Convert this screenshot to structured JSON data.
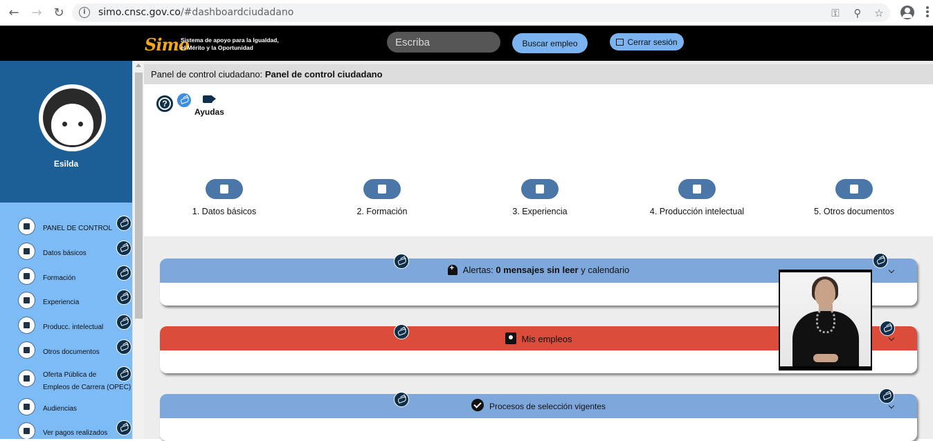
{
  "browser": {
    "url_host": "simo.cnsc.gov.co",
    "url_path": "/#dashboardciudadano"
  },
  "header": {
    "logo_text": "Simo",
    "logo_tagline_1": "Sistema de apoyo para la Igualdad,",
    "logo_tagline_2": "el Mérito y la Oportunidad",
    "search_placeholder": "Escriba",
    "search_button": "Buscar empleo",
    "logout_button": "Cerrar sesión"
  },
  "sidebar": {
    "user_name": "Esilda",
    "items": [
      {
        "label": "PANEL DE CONTROL",
        "icon": "dashboard-icon"
      },
      {
        "label": "Datos básicos",
        "icon": "people-icon"
      },
      {
        "label": "Formación",
        "icon": "book-icon"
      },
      {
        "label": "Experiencia",
        "icon": "briefcase-icon"
      },
      {
        "label": "Producc. intelectual",
        "icon": "library-icon"
      },
      {
        "label": "Otros documentos",
        "icon": "document-icon"
      },
      {
        "label": "Oferta Pública de",
        "label2": "Empleos de Carrera (OPEC)",
        "icon": "opec-icon"
      },
      {
        "label": "Audiencias",
        "icon": "audience-icon"
      },
      {
        "label": "Ver pagos realizados",
        "icon": "dollar-icon"
      }
    ]
  },
  "main": {
    "breadcrumb_prefix": "Panel de control ciudadano:",
    "breadcrumb_current": "Panel de control ciudadano",
    "help_label": "Ayudas",
    "steps": [
      {
        "label": "1. Datos básicos",
        "icon": "people-icon"
      },
      {
        "label": "2. Formación",
        "icon": "book-icon"
      },
      {
        "label": "3. Experiencia",
        "icon": "briefcase-icon"
      },
      {
        "label": "4. Producción intelectual",
        "icon": "library-icon"
      },
      {
        "label": "5. Otros documentos",
        "icon": "document-icon"
      }
    ],
    "cards": {
      "alerts_prefix": "Alertas:",
      "alerts_bold": "0 mensajes sin leer",
      "alerts_suffix": "y calendario",
      "jobs_title": "Mis empleos",
      "processes_title": "Procesos de selección vigentes"
    }
  },
  "colors": {
    "alerts_header": "#7ea8dc",
    "jobs_header": "#dc4c3a",
    "processes_header": "#7ea8dc",
    "sidebar_top": "#1c5f96",
    "sidebar_bg": "#7dbbf7"
  }
}
